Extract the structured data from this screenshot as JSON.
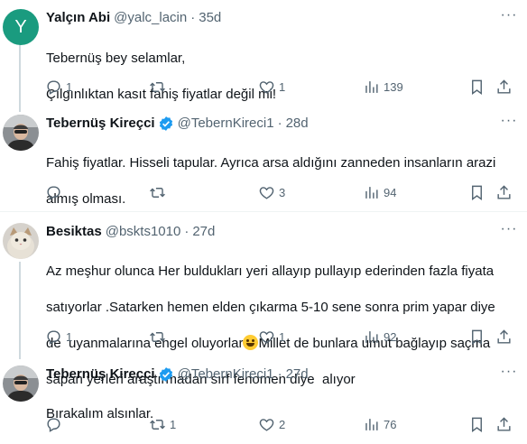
{
  "tweets": [
    {
      "avatar_letter": "Y",
      "name": "Yalçın Abi",
      "handle": "@yalc_lacin",
      "sep": "·",
      "time": "35d",
      "lines": [
        "Tebernüş bey selamlar,",
        "Çılgınlıktan kasıt fahiş fiyatlar değil mi!"
      ],
      "replies": "1",
      "retweets": "",
      "likes": "1",
      "views": "139"
    },
    {
      "name": "Tebernüş Kireçci",
      "handle": "@TebernKireci1",
      "sep": "·",
      "time": "28d",
      "lines": [
        "Fahiş fiyatlar. Hisseli tapular. Ayrıca arsa aldığını zanneden insanların arazi",
        "almış olması."
      ],
      "replies": "",
      "retweets": "",
      "likes": "3",
      "views": "94"
    },
    {
      "name": "Besiktas",
      "handle": "@bskts1010",
      "sep": "·",
      "time": "27d",
      "lines": [
        "Az meşhur olunca Her buldukları yeri allayıp pullayıp ederinden fazla fiyata",
        "satıyorlar .Satarken hemen elden çıkarma 5-10 sene sonra prim yapar diye"
      ],
      "line3_a": "de  uyanmalarına engel oluyorlar",
      "line3_b": "Millet de bunlara umut bağlayıp saçma",
      "line4": "sapan yerleri araştırmadan sırf fenomen diye  alıyor",
      "replies": "1",
      "retweets": "",
      "likes": "1",
      "views": "92"
    },
    {
      "name": "Tebernüş Kireçci",
      "handle": "@TebernKireci1",
      "sep": "·",
      "time": "27d",
      "lines": [
        "Bırakalım alsınlar."
      ],
      "replies": "",
      "retweets": "1",
      "likes": "2",
      "views": "76"
    }
  ],
  "icons": {
    "reply": "reply-icon",
    "retweet": "retweet-icon",
    "like": "heart-icon",
    "views": "views-icon",
    "bookmark": "bookmark-icon",
    "share": "share-icon",
    "more": "more-icon",
    "verified": "verified-badge-icon"
  },
  "colors": {
    "text": "#0f1419",
    "secondary": "#536471",
    "verified": "#1d9bf0",
    "thread_line": "#cfd9de",
    "avatar_y": "#1a9b7f"
  }
}
